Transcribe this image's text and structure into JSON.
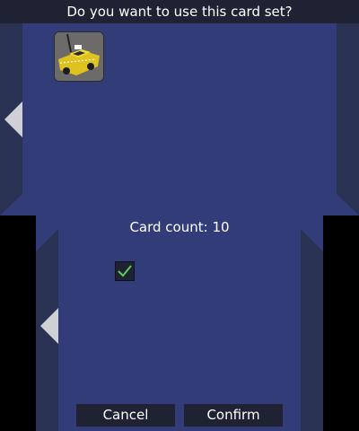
{
  "top": {
    "title": "Do you want to use this card set?",
    "card_icon": "taxi-card-icon"
  },
  "bottom": {
    "card_count": "Card count: 10",
    "checkbox_checked": true,
    "cancel_label": "Cancel",
    "confirm_label": "Confirm"
  },
  "colors": {
    "panel": "#323c78",
    "side": "#2a3254",
    "bar": "#1f2233",
    "check": "#58d058"
  }
}
